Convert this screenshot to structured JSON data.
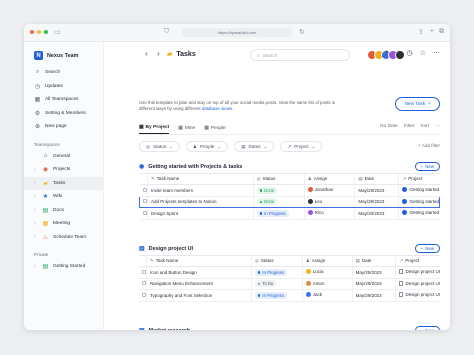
{
  "browser": {
    "url": "https://byseafolio.com"
  },
  "sidebar": {
    "workspace": "Nexus Team",
    "top_items": [
      {
        "label": "Search",
        "icon": "search-icon"
      },
      {
        "label": "Updates",
        "icon": "clock-icon"
      },
      {
        "label": "All Teamspaces",
        "icon": "grid-icon"
      },
      {
        "label": "Setting & Members",
        "icon": "gear-icon"
      },
      {
        "label": "New page",
        "icon": "plus-icon"
      }
    ],
    "teamspaces_label": "Teamspaces",
    "teamspaces": [
      {
        "label": "General",
        "icon": "home-icon",
        "chevron": false
      },
      {
        "label": "Projects",
        "icon": "target-icon",
        "chevron": true
      },
      {
        "label": "Tasks",
        "icon": "folder-icon",
        "chevron": true,
        "active": true
      },
      {
        "label": "Wiki",
        "icon": "star-icon",
        "chevron": true
      },
      {
        "label": "Docs",
        "icon": "doc-icon",
        "chevron": true
      },
      {
        "label": "Meeting",
        "icon": "calendar-icon",
        "chevron": true
      },
      {
        "label": "Schedule Team",
        "icon": "fire-icon",
        "chevron": true
      }
    ],
    "private_label": "Private",
    "private": [
      {
        "label": "Getting Started",
        "icon": "doc-icon",
        "chevron": true
      }
    ]
  },
  "header": {
    "title": "Tasks",
    "search_placeholder": "Search",
    "description": "Use this template to plan and stay on top of all your social media posts. View the same list of posts in different ways by using different ",
    "description_link": "database views.",
    "new_task_label": "New Task"
  },
  "views": {
    "tabs": [
      "By Project",
      "Mine",
      "People"
    ],
    "active": "By Project",
    "right": [
      "No Date",
      "Filter",
      "Sort"
    ]
  },
  "filters": {
    "chips": [
      "Status",
      "People",
      "Dates",
      "Project"
    ],
    "add_filter": "Add filter"
  },
  "columns": [
    "Task Name",
    "Status",
    "Assign",
    "Date",
    "Project"
  ],
  "groups": [
    {
      "title": "Getting started with Projects & tasks",
      "new_label": "New",
      "rows": [
        {
          "task": "Invite team members",
          "status": "Done",
          "assign": "Jonathan",
          "date": "May/29/2023",
          "project": "Getting started"
        },
        {
          "task": "Add Projects templates to Notion",
          "status": "Done",
          "assign": "Leo",
          "date": "May/29/2023",
          "project": "Getting started",
          "selected": true
        },
        {
          "task": "Design Sprint",
          "status": "In Progress",
          "assign": "Rico",
          "date": "May/30/2023",
          "project": "Getting started"
        }
      ]
    },
    {
      "title": "Design project UI",
      "new_label": "New",
      "rows": [
        {
          "task": "Icon and Button Design",
          "status": "In Progress",
          "assign": "Lucia",
          "date": "May/29/2023",
          "project": "Design project UI"
        },
        {
          "task": "Navigation Menu Enhancement",
          "status": "To Do",
          "assign": "Anton",
          "date": "May/29/2023",
          "project": "Design project UI"
        },
        {
          "task": "Typography and Font Selection",
          "status": "In Progress",
          "assign": "Jack",
          "date": "May/29/2023",
          "project": "Design project UI"
        }
      ]
    },
    {
      "title": "Market research",
      "new_label": "New",
      "rows": []
    }
  ],
  "colors": {
    "accent": "#1f5fd9",
    "done": "#22a05a",
    "selected_border": "#3b73e6"
  }
}
